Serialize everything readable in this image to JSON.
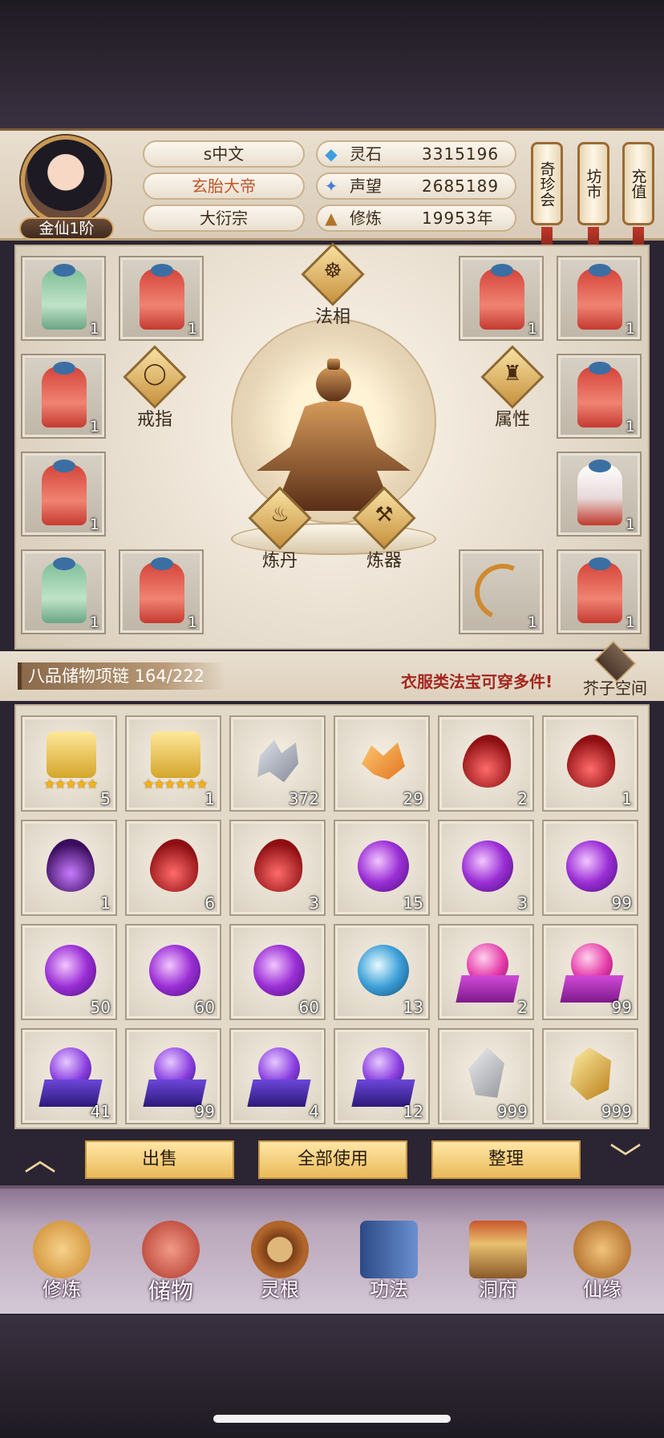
{
  "header": {
    "rank": "金仙1阶",
    "name": "s中文",
    "title": "玄胎大帝",
    "sect": "大衍宗",
    "resources": [
      {
        "label": "灵石",
        "value": "3315196",
        "icon": "spirit-stone-icon"
      },
      {
        "label": "声望",
        "value": "2685189",
        "icon": "reputation-icon"
      },
      {
        "label": "修炼",
        "value": "19953年",
        "icon": "cultivation-icon"
      }
    ],
    "side_buttons": [
      {
        "label": "奇珍会"
      },
      {
        "label": "坊市"
      },
      {
        "label": "充值"
      }
    ]
  },
  "equipment": {
    "center_buttons": {
      "faxiang": "法相",
      "ring": "戒指",
      "attributes": "属性",
      "alchemy": "炼丹",
      "forging": "炼器"
    },
    "slots": [
      {
        "kind": "green",
        "count": "1"
      },
      {
        "kind": "red",
        "count": "1"
      },
      {
        "kind": "red",
        "count": "1"
      },
      {
        "kind": "red",
        "count": "1"
      },
      {
        "kind": "red",
        "count": "1"
      },
      {
        "kind": "red",
        "count": "1"
      },
      {
        "kind": "red",
        "count": "1"
      },
      {
        "kind": "white",
        "count": "1"
      },
      {
        "kind": "green",
        "count": "1"
      },
      {
        "kind": "red",
        "count": "1"
      },
      {
        "kind": "bow",
        "count": "1"
      },
      {
        "kind": "red",
        "count": "1"
      }
    ]
  },
  "inventory": {
    "title": "八品储物项链 164/222",
    "hint": "衣服类法宝可穿多件!",
    "space_label": "芥子空间",
    "items": [
      {
        "kind": "scroll",
        "stars": "★★★★★",
        "count": "5"
      },
      {
        "kind": "scroll",
        "stars": "★★★★★★",
        "count": "1"
      },
      {
        "kind": "shards",
        "count": "372"
      },
      {
        "kind": "shards-gold",
        "count": "29"
      },
      {
        "kind": "flame-red",
        "count": "2"
      },
      {
        "kind": "flame-red",
        "count": "1"
      },
      {
        "kind": "flame-purple",
        "count": "1"
      },
      {
        "kind": "flame-red",
        "count": "6"
      },
      {
        "kind": "flame-red",
        "count": "3"
      },
      {
        "kind": "orb-purple",
        "count": "15"
      },
      {
        "kind": "orb-purple",
        "count": "3"
      },
      {
        "kind": "orb-purple",
        "count": "99"
      },
      {
        "kind": "orb-purple",
        "count": "50"
      },
      {
        "kind": "orb-purple",
        "count": "60"
      },
      {
        "kind": "orb-purple",
        "count": "60"
      },
      {
        "kind": "orb-blue",
        "count": "13"
      },
      {
        "kind": "pedestal-pink",
        "count": "2"
      },
      {
        "kind": "pedestal-pink",
        "count": "99"
      },
      {
        "kind": "pedestal-purple",
        "count": "41"
      },
      {
        "kind": "pedestal-purple",
        "count": "99"
      },
      {
        "kind": "pedestal-purple",
        "count": "4"
      },
      {
        "kind": "pedestal-purple",
        "count": "12"
      },
      {
        "kind": "stone-grey",
        "count": "999"
      },
      {
        "kind": "stone-gold",
        "count": "999"
      }
    ]
  },
  "actions": {
    "sell": "出售",
    "use_all": "全部使用",
    "sort": "整理"
  },
  "nav": [
    {
      "label": "修炼",
      "icon": "cultivate-icon",
      "color": "#d99a3a"
    },
    {
      "label": "储物",
      "icon": "storage-bag-icon",
      "color": "#c0453a"
    },
    {
      "label": "灵根",
      "icon": "spirit-root-icon",
      "color": "#b0652a"
    },
    {
      "label": "功法",
      "icon": "technique-book-icon",
      "color": "#4a6fb0"
    },
    {
      "label": "洞府",
      "icon": "cave-house-icon",
      "color": "#b8862f"
    },
    {
      "label": "仙缘",
      "icon": "fate-gourd-icon",
      "color": "#c9852a"
    }
  ]
}
